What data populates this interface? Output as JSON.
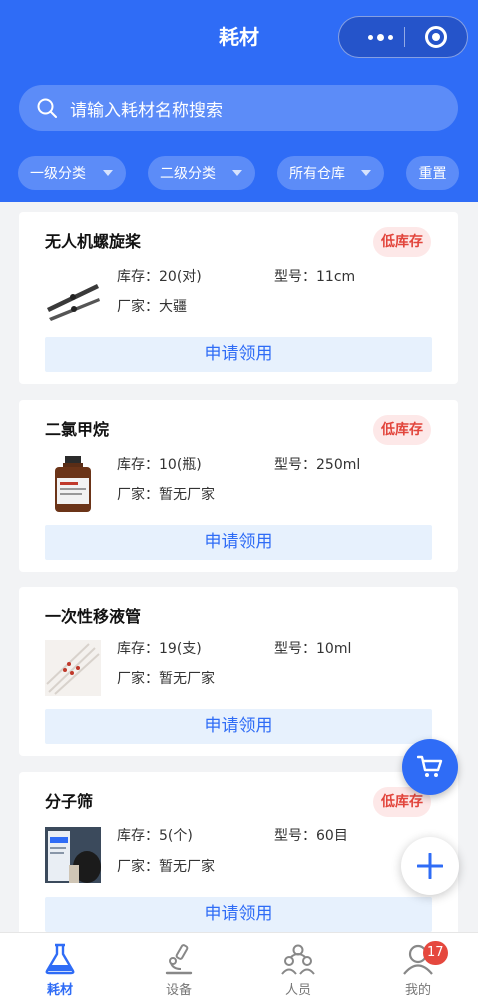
{
  "header": {
    "title": "耗材",
    "menu_icon": "more-dots-icon",
    "close_icon": "target-icon"
  },
  "search": {
    "placeholder": "请输入耗材名称搜索"
  },
  "filters": {
    "level1": "一级分类",
    "level2": "二级分类",
    "warehouse": "所有仓库",
    "reset": "重置"
  },
  "labels": {
    "stock": "库存：",
    "model": "型号：",
    "maker": "厂家：",
    "apply": "申请领用"
  },
  "items": [
    {
      "name": "无人机螺旋桨",
      "badge": "低库存",
      "stock": "20(对)",
      "model": "11cm",
      "maker": "大疆",
      "thumb_icon": "propeller-image"
    },
    {
      "name": "二氯甲烷",
      "badge": "低库存",
      "stock": "10(瓶)",
      "model": "250ml",
      "maker": "暂无厂家",
      "thumb_icon": "reagent-bottle-image"
    },
    {
      "name": "一次性移液管",
      "badge": "",
      "stock": "19(支)",
      "model": "10ml",
      "maker": "暂无厂家",
      "thumb_icon": "pipette-image"
    },
    {
      "name": "分子筛",
      "badge": "低库存",
      "stock": "5(个)",
      "model": "60目",
      "maker": "暂无厂家",
      "thumb_icon": "molecular-sieve-image"
    }
  ],
  "fab": {
    "cart_icon": "cart-icon",
    "add_icon": "plus-icon"
  },
  "tabs": [
    {
      "label": "耗材",
      "icon": "flask-icon",
      "active": true
    },
    {
      "label": "设备",
      "icon": "microscope-icon",
      "active": false
    },
    {
      "label": "人员",
      "icon": "people-icon",
      "active": false
    },
    {
      "label": "我的",
      "icon": "user-icon",
      "active": false,
      "badge": "17"
    }
  ],
  "colors": {
    "primary": "#2f6cf6",
    "danger": "#e2453c",
    "background": "#f2f3f5"
  }
}
